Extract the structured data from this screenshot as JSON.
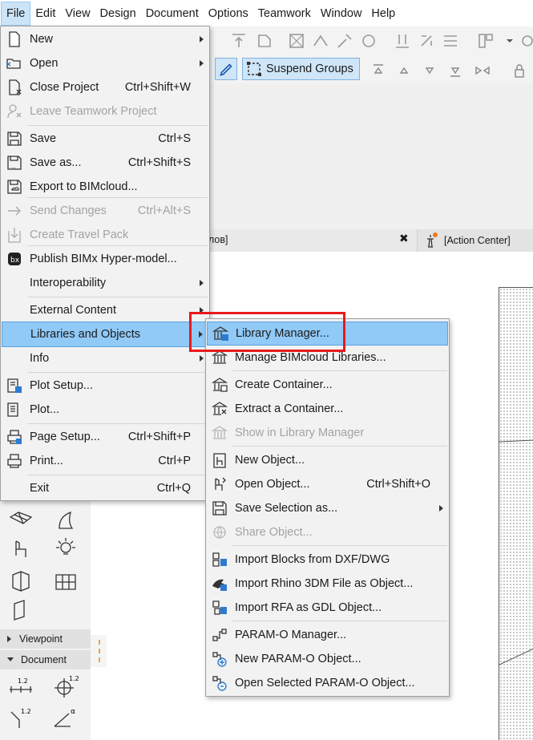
{
  "menubar": [
    "File",
    "Edit",
    "View",
    "Design",
    "Document",
    "Options",
    "Teamwork",
    "Window",
    "Help"
  ],
  "toolbar": {
    "suspend_groups": "Suspend Groups"
  },
  "tabs": {
    "fragment": "лов]",
    "close": "✖",
    "action_center": "[Action Center]"
  },
  "palette": {
    "viewpoint": "Viewpoint",
    "document": "Document"
  },
  "file_menu": [
    {
      "label": "New",
      "arrow": true,
      "icon": "new-document-icon"
    },
    {
      "label": "Open",
      "arrow": true,
      "icon": "open-folder-icon"
    },
    {
      "label": "Close Project",
      "shortcut": "Ctrl+Shift+W",
      "icon": "close-project-icon"
    },
    {
      "label": "Leave Teamwork Project",
      "disabled": true,
      "icon": "leave-teamwork-icon"
    },
    {
      "label": "Save",
      "shortcut": "Ctrl+S",
      "icon": "save-icon"
    },
    {
      "label": "Save as...",
      "shortcut": "Ctrl+Shift+S",
      "icon": "save-as-icon"
    },
    {
      "label": "Export to BIMcloud...",
      "icon": "export-bimcloud-icon"
    },
    {
      "label": "Send Changes",
      "shortcut": "Ctrl+Alt+S",
      "disabled": true,
      "icon": "send-changes-icon"
    },
    {
      "label": "Create Travel Pack",
      "disabled": true,
      "icon": "travel-pack-icon"
    },
    {
      "label": "Publish BIMx Hyper-model...",
      "icon": "bimx-icon"
    },
    {
      "label": "Interoperability",
      "arrow": true
    },
    {
      "label": "External Content",
      "arrow": true
    },
    {
      "label": "Libraries and Objects",
      "arrow": true,
      "highlight": true
    },
    {
      "label": "Info",
      "arrow": true
    },
    {
      "label": "Plot Setup...",
      "icon": "plot-setup-icon"
    },
    {
      "label": "Plot...",
      "icon": "plot-icon"
    },
    {
      "label": "Page Setup...",
      "shortcut": "Ctrl+Shift+P",
      "icon": "page-setup-icon"
    },
    {
      "label": "Print...",
      "shortcut": "Ctrl+P",
      "icon": "print-icon"
    },
    {
      "label": "Exit",
      "shortcut": "Ctrl+Q"
    }
  ],
  "sub_menu": [
    {
      "label": "Library Manager...",
      "highlight": true,
      "icon": "library-manager-icon"
    },
    {
      "label": "Manage BIMcloud Libraries...",
      "icon": "bimcloud-libraries-icon"
    },
    {
      "label": "Create Container...",
      "icon": "create-container-icon"
    },
    {
      "label": "Extract a Container...",
      "icon": "extract-container-icon"
    },
    {
      "label": "Show in Library Manager",
      "disabled": true,
      "icon": "show-library-icon"
    },
    {
      "label": "New Object...",
      "icon": "new-object-icon"
    },
    {
      "label": "Open Object...",
      "shortcut": "Ctrl+Shift+O",
      "icon": "open-object-icon"
    },
    {
      "label": "Save Selection as...",
      "arrow": true,
      "icon": "save-selection-icon"
    },
    {
      "label": "Share Object...",
      "disabled": true,
      "icon": "share-object-icon"
    },
    {
      "label": "Import Blocks from DXF/DWG",
      "icon": "import-dxf-icon"
    },
    {
      "label": "Import Rhino 3DM File as Object...",
      "icon": "import-rhino-icon"
    },
    {
      "label": "Import RFA as GDL Object...",
      "icon": "import-rfa-icon"
    },
    {
      "label": "PARAM-O Manager...",
      "icon": "param-o-manager-icon"
    },
    {
      "label": "New PARAM-O Object...",
      "icon": "new-param-o-icon"
    },
    {
      "label": "Open Selected PARAM-O Object...",
      "icon": "open-param-o-icon"
    }
  ]
}
